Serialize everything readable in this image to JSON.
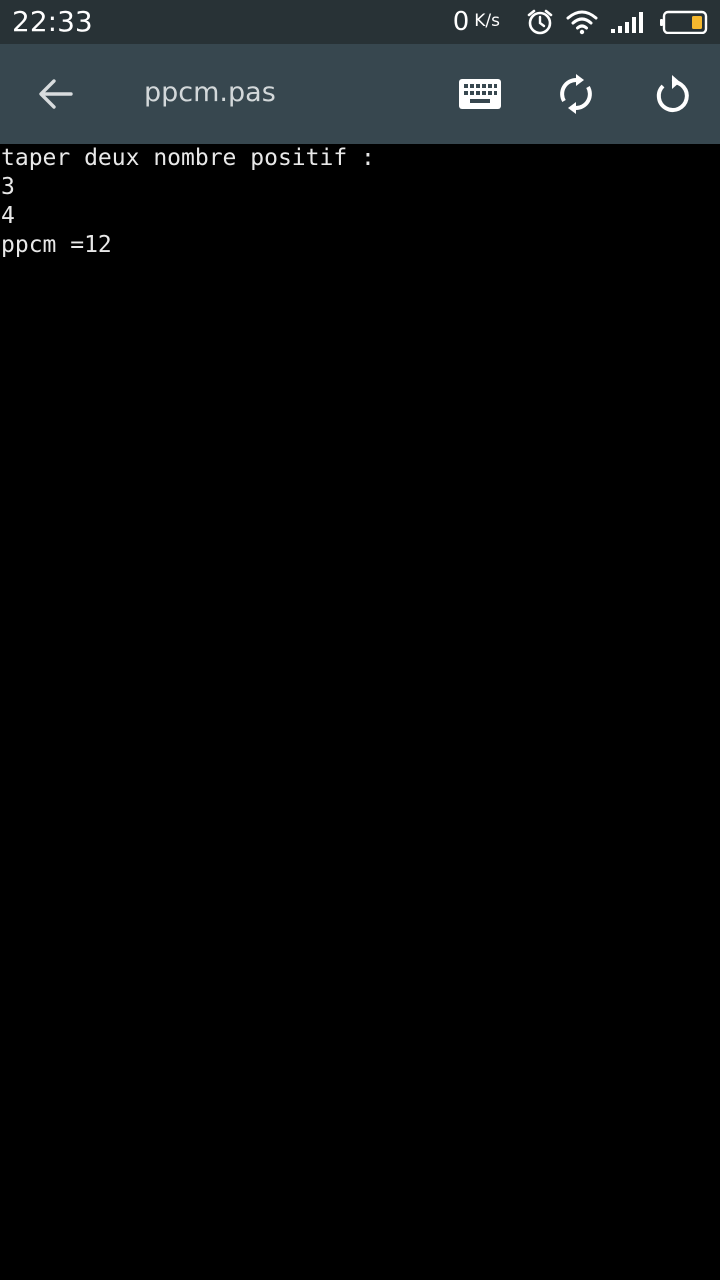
{
  "status_bar": {
    "time": "22:33",
    "net_speed_value": "0",
    "net_speed_unit": "K/s",
    "battery_color": "#f5b82e",
    "icons": [
      "alarm-icon",
      "wifi-icon",
      "signal-icon",
      "battery-icon"
    ]
  },
  "toolbar": {
    "title": "ppcm.pas",
    "icons": [
      "back-arrow-icon",
      "keyboard-icon",
      "sync-icon",
      "refresh-icon"
    ]
  },
  "console": {
    "lines": [
      "taper deux nombre positif :",
      "3",
      "4",
      "ppcm =12"
    ]
  },
  "colors": {
    "status_bar_bg": "#283236",
    "toolbar_bg": "#37474f",
    "console_bg": "#000000",
    "console_text": "#e8e8e8"
  }
}
